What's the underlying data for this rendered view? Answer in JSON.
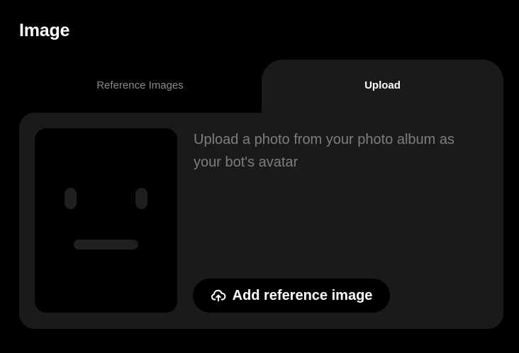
{
  "section": {
    "title": "Image"
  },
  "tabs": [
    {
      "label": "Reference Images",
      "active": false
    },
    {
      "label": "Upload",
      "active": true
    }
  ],
  "upload": {
    "description": "Upload a photo from your photo album as your bot's avatar",
    "button_label": "Add reference image",
    "button_icon": "cloud-upload-icon",
    "placeholder_icon": "face-placeholder-icon"
  },
  "colors": {
    "background": "#000000",
    "panel": "#1a1a1a",
    "muted_text": "#7e7e7e",
    "inactive_tab_text": "#8a8a8a",
    "active_text": "#ffffff"
  }
}
